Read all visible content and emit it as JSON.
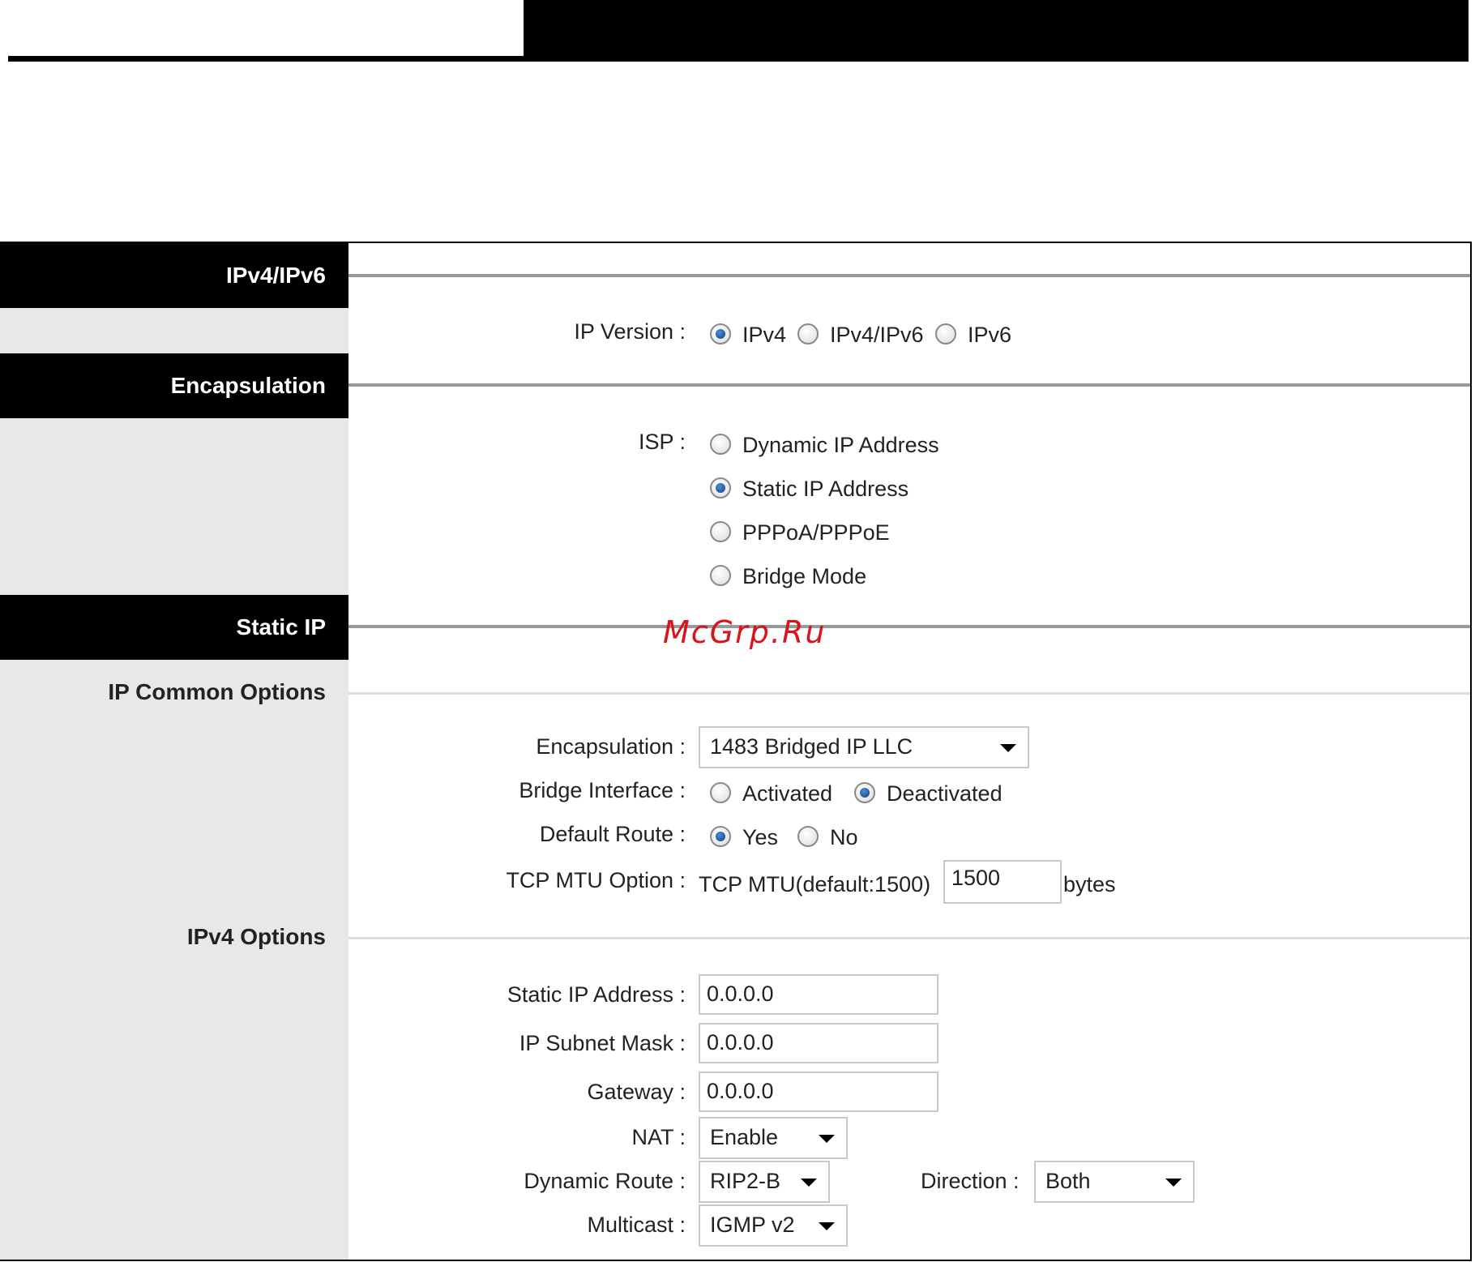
{
  "sections": {
    "ipv4_ipv6": "IPv4/IPv6",
    "encapsulation": "Encapsulation",
    "static_ip": "Static IP",
    "ip_common_options": "IP Common Options",
    "ipv4_options": "IPv4 Options"
  },
  "ip_version": {
    "label": "IP Version :",
    "options": [
      "IPv4",
      "IPv4/IPv6",
      "IPv6"
    ],
    "selected": "IPv4"
  },
  "isp": {
    "label": "ISP :",
    "options": [
      "Dynamic IP Address",
      "Static IP Address",
      "PPPoA/PPPoE",
      "Bridge Mode"
    ],
    "selected": "Static IP Address"
  },
  "common": {
    "encapsulation_label": "Encapsulation :",
    "encapsulation_value": "1483 Bridged IP LLC",
    "bridge_interface_label": "Bridge Interface :",
    "bridge_interface_options": [
      "Activated",
      "Deactivated"
    ],
    "bridge_interface_selected": "Deactivated",
    "default_route_label": "Default Route :",
    "default_route_options": [
      "Yes",
      "No"
    ],
    "default_route_selected": "Yes",
    "tcp_mtu_label": "TCP MTU Option :",
    "tcp_mtu_text": "TCP MTU(default:1500)",
    "tcp_mtu_value": "1500",
    "tcp_mtu_unit": "bytes"
  },
  "ipv4": {
    "static_ip_label": "Static IP Address :",
    "static_ip_value": "0.0.0.0",
    "subnet_label": "IP Subnet Mask :",
    "subnet_value": "0.0.0.0",
    "gateway_label": "Gateway :",
    "gateway_value": "0.0.0.0",
    "nat_label": "NAT :",
    "nat_value": "Enable",
    "dynamic_route_label": "Dynamic Route :",
    "dynamic_route_value": "RIP2-B",
    "direction_label": "Direction :",
    "direction_value": "Both",
    "multicast_label": "Multicast :",
    "multicast_value": "IGMP v2"
  },
  "watermark": "McGrp.Ru",
  "colors": {
    "header_bg": "#000000",
    "left_column_bg": "#e8e8e8",
    "radio_selected": "#1f5fa8",
    "watermark": "#d8141d"
  }
}
